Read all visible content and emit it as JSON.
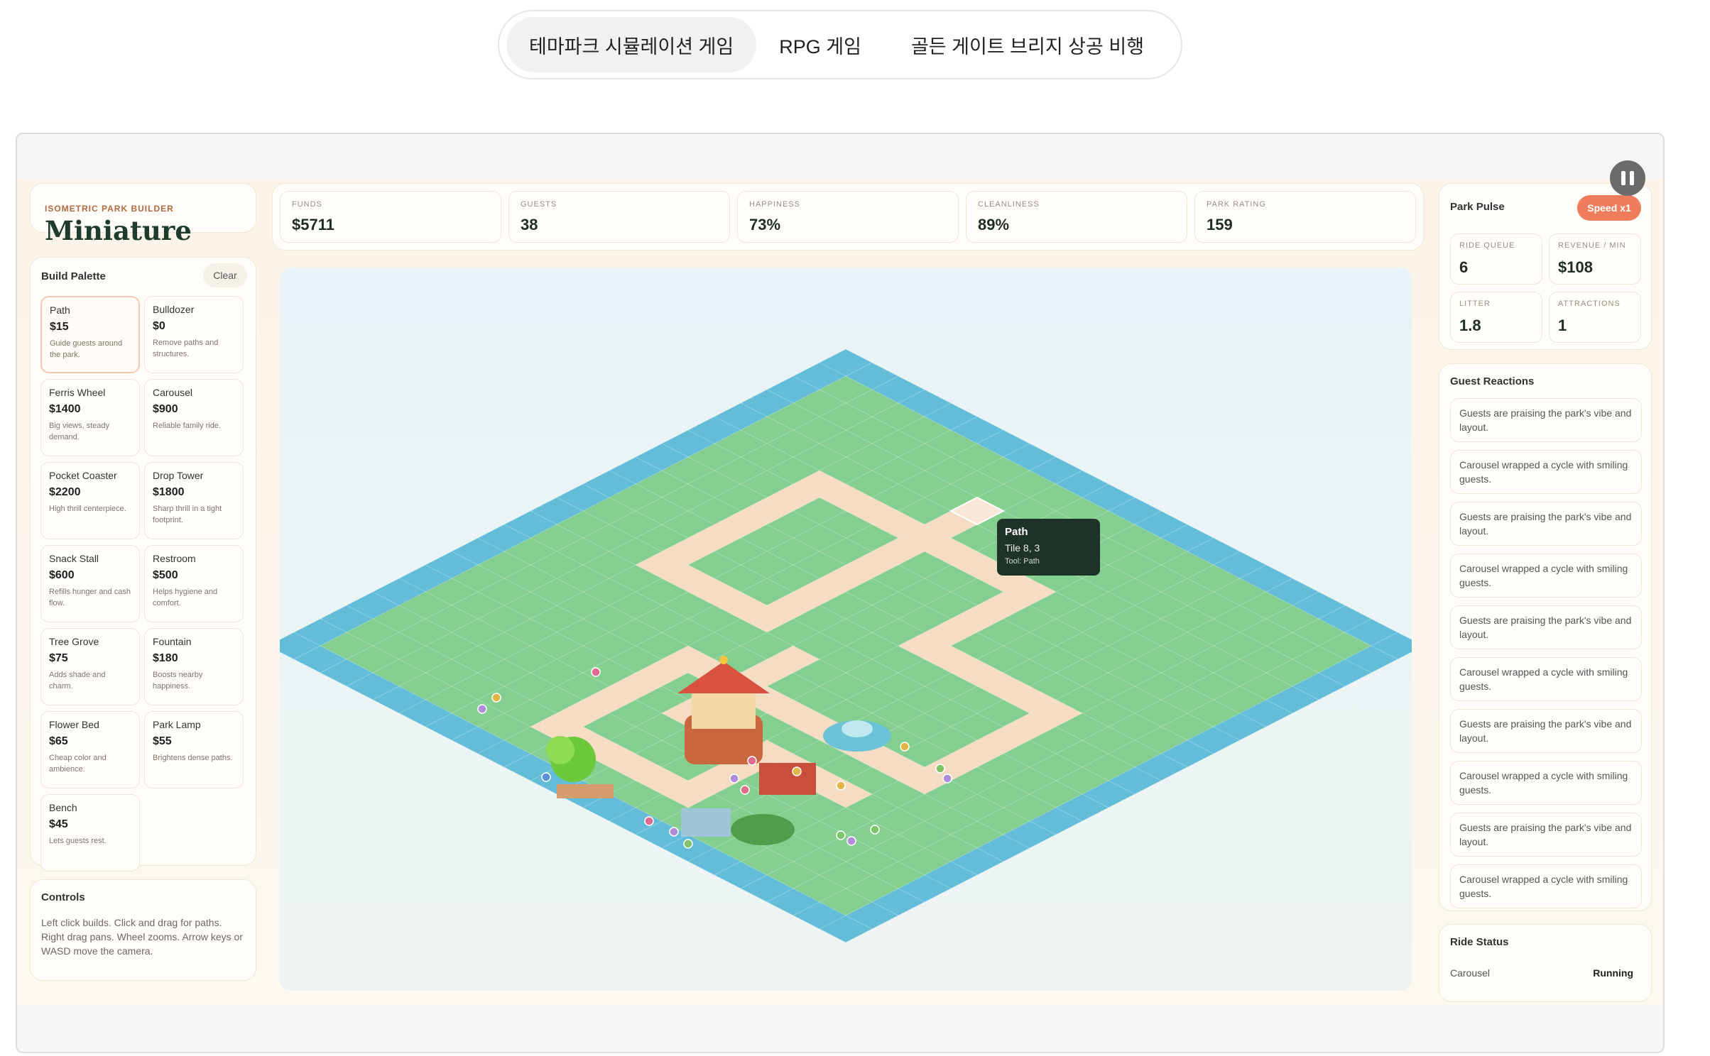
{
  "tabs": [
    {
      "label": "테마파크 시뮬레이션 게임",
      "active": true
    },
    {
      "label": "RPG 게임",
      "active": false
    },
    {
      "label": "골든 게이트 브리지 상공 비행",
      "active": false
    }
  ],
  "brand": {
    "eyebrow": "ISOMETRIC PARK BUILDER",
    "title": "Miniature"
  },
  "palette": {
    "title": "Build Palette",
    "clear_label": "Clear",
    "items": [
      {
        "name": "Path",
        "price": "$15",
        "desc": "Guide guests around the park.",
        "selected": true
      },
      {
        "name": "Bulldozer",
        "price": "$0",
        "desc": "Remove paths and structures."
      },
      {
        "name": "Ferris Wheel",
        "price": "$1400",
        "desc": "Big views, steady demand."
      },
      {
        "name": "Carousel",
        "price": "$900",
        "desc": "Reliable family ride."
      },
      {
        "name": "Pocket Coaster",
        "price": "$2200",
        "desc": "High thrill centerpiece."
      },
      {
        "name": "Drop Tower",
        "price": "$1800",
        "desc": "Sharp thrill in a tight footprint."
      },
      {
        "name": "Snack Stall",
        "price": "$600",
        "desc": "Refills hunger and cash flow."
      },
      {
        "name": "Restroom",
        "price": "$500",
        "desc": "Helps hygiene and comfort."
      },
      {
        "name": "Tree Grove",
        "price": "$75",
        "desc": "Adds shade and charm."
      },
      {
        "name": "Fountain",
        "price": "$180",
        "desc": "Boosts nearby happiness."
      },
      {
        "name": "Flower Bed",
        "price": "$65",
        "desc": "Cheap color and ambience."
      },
      {
        "name": "Park Lamp",
        "price": "$55",
        "desc": "Brightens dense paths."
      },
      {
        "name": "Bench",
        "price": "$45",
        "desc": "Lets guests rest."
      }
    ]
  },
  "controls": {
    "title": "Controls",
    "text": "Left click builds. Click and drag for paths. Right drag pans. Wheel zooms. Arrow keys or WASD move the camera."
  },
  "stats": [
    {
      "label": "FUNDS",
      "value": "$5711"
    },
    {
      "label": "GUESTS",
      "value": "38"
    },
    {
      "label": "HAPPINESS",
      "value": "73%"
    },
    {
      "label": "CLEANLINESS",
      "value": "89%"
    },
    {
      "label": "PARK RATING",
      "value": "159"
    }
  ],
  "tooltip": {
    "title": "Path",
    "tile": "Tile 8, 3",
    "tool": "Tool: Path"
  },
  "pulse": {
    "title": "Park Pulse",
    "speed": "Speed x1",
    "metrics": [
      {
        "label": "RIDE QUEUE",
        "value": "6"
      },
      {
        "label": "REVENUE / MIN",
        "value": "$108"
      },
      {
        "label": "LITTER",
        "value": "1.8"
      },
      {
        "label": "ATTRACTIONS",
        "value": "1"
      }
    ]
  },
  "reactions": {
    "title": "Guest Reactions",
    "items": [
      "Guests are praising the park's vibe and layout.",
      "Carousel wrapped a cycle with smiling guests.",
      "Guests are praising the park's vibe and layout.",
      "Carousel wrapped a cycle with smiling guests.",
      "Guests are praising the park's vibe and layout.",
      "Carousel wrapped a cycle with smiling guests.",
      "Guests are praising the park's vibe and layout.",
      "Carousel wrapped a cycle with smiling guests.",
      "Guests are praising the park's vibe and layout.",
      "Carousel wrapped a cycle with smiling guests."
    ]
  },
  "ride_status": {
    "title": "Ride Status",
    "rows": [
      {
        "name": "Carousel",
        "status": "Running"
      }
    ]
  },
  "colors": {
    "grass": "#84cf8f",
    "water": "#63bdd9",
    "path": "#f6dcc3",
    "accent": "#ef7d5c",
    "dark": "#1e3328"
  }
}
